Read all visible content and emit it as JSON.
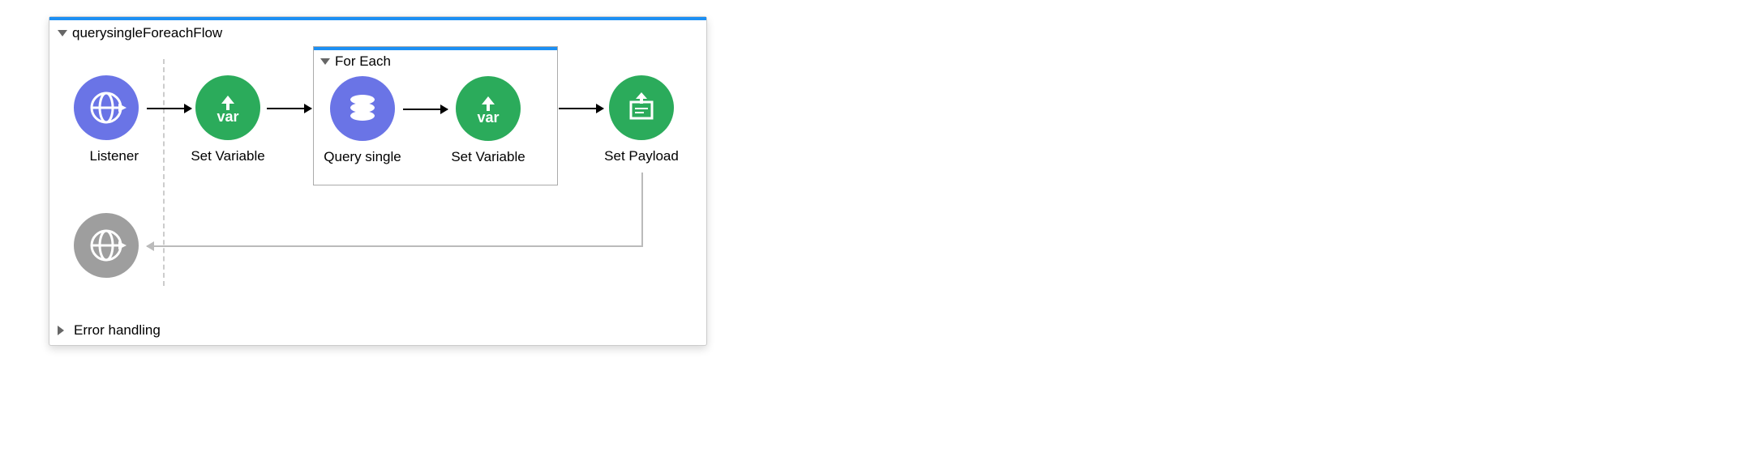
{
  "flow": {
    "name": "querysingleForeachFlow",
    "errorSection": "Error handling",
    "scope": {
      "name": "For Each"
    },
    "nodes": {
      "listener": {
        "label": "Listener"
      },
      "setVar1": {
        "label": "Set Variable"
      },
      "querySingle": {
        "label": "Query single"
      },
      "setVar2": {
        "label": "Set Variable"
      },
      "setPayload": {
        "label": "Set Payload"
      }
    }
  }
}
